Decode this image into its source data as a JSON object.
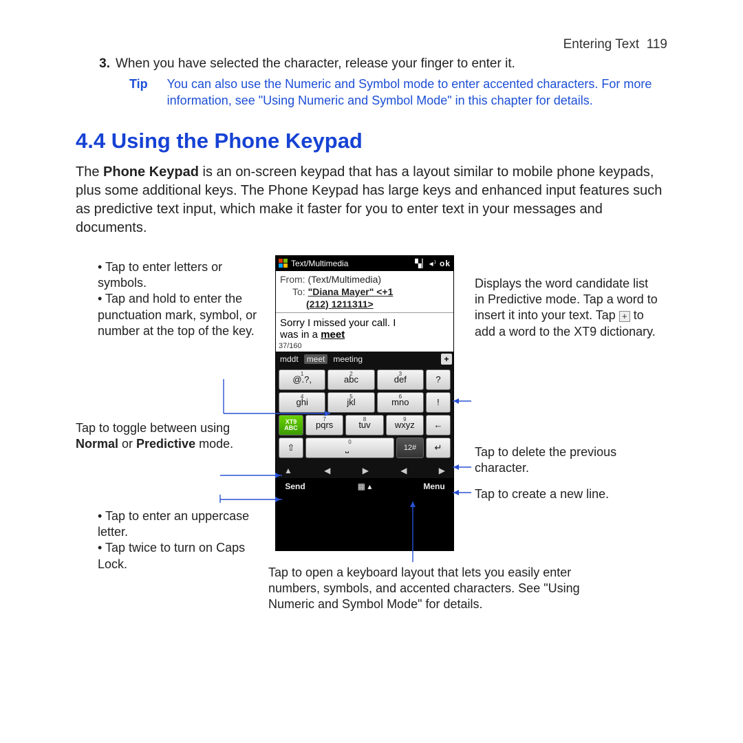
{
  "header": {
    "section": "Entering Text",
    "page_num": "119"
  },
  "step": {
    "num": "3.",
    "text": "When you have selected the character, release your finger to enter it."
  },
  "tip": {
    "label": "Tip",
    "text": "You can also use the Numeric and Symbol mode to enter accented characters. For more information, see \"Using Numeric and Symbol Mode\" in this chapter for details."
  },
  "heading": "4.4  Using the Phone Keypad",
  "intro": {
    "pre": "The ",
    "bold": "Phone Keypad",
    "post": " is an on-screen keypad that has a layout similar to mobile phone keypads, plus some additional keys. The Phone Keypad has large keys and enhanced input features such as predictive text input, which make it faster for you to enter text in your messages and documents."
  },
  "phone": {
    "title": "Text/Multimedia",
    "ok": "ok",
    "from_lbl": "From:",
    "from_val": "(Text/Multimedia)",
    "to_lbl": "To:",
    "to_line1": "\"Diana Mayer\" <+1",
    "to_line2": "(212) 1211311>",
    "msg_line1": "Sorry I missed your call. I",
    "msg_line2_pre": "was in a ",
    "msg_line2_last": "meet",
    "count": "37/160",
    "pred": {
      "w1": "mddt",
      "w2": "meet",
      "w3": "meeting",
      "plus": "+"
    },
    "keys": {
      "r1": [
        "@.?,",
        "abc",
        "def",
        "?"
      ],
      "r1sup": [
        "1",
        "2",
        "3",
        ""
      ],
      "r2": [
        "ghi",
        "jkl",
        "mno",
        "!"
      ],
      "r2sup": [
        "4",
        "5",
        "6",
        ""
      ],
      "r3_mode_t": "XT9",
      "r3_mode_b": "ABC",
      "r3": [
        "pqrs",
        "tuv",
        "wxyz",
        "←"
      ],
      "r3sup": [
        "7",
        "8",
        "9",
        ""
      ],
      "r4_shift": "⇧",
      "r4_space": "␣",
      "r4_space_sup": "0",
      "r4_12": "12#",
      "r4_enter": "↵"
    },
    "arrows": {
      "a1": "▲",
      "a2": "◀",
      "a3": "▶",
      "a4": "◀",
      "a5": "▶"
    },
    "bottom": {
      "send": "Send",
      "menu": "Menu",
      "mid": "▦ ▴"
    }
  },
  "ann": {
    "left1_a": "Tap to enter letters or symbols.",
    "left1_b": "Tap and hold to enter the punctuation mark, symbol, or number at the top of the key.",
    "left2_pre": "Tap to toggle between using ",
    "left2_b1": "Normal",
    "left2_mid": " or ",
    "left2_b2": "Predictive",
    "left2_post": " mode.",
    "left3_a": "Tap to enter an uppercase letter.",
    "left3_b": "Tap twice to turn on Caps Lock.",
    "right1_pre": "Displays the word candidate list in Predictive mode. Tap a word to insert it into your text. Tap ",
    "right1_post": " to add a word to the XT9 dictionary.",
    "right2": "Tap to delete the previous character.",
    "right3": "Tap to create a new line.",
    "bottom": "Tap to open a keyboard layout that lets you easily enter numbers, symbols, and accented characters. See \"Using Numeric and Symbol Mode\" for details."
  }
}
